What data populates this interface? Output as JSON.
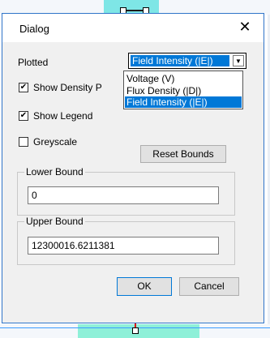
{
  "dialog": {
    "title": "Dialog",
    "close_glyph": "✕"
  },
  "plotted": {
    "label": "Plotted",
    "selected": "Field Intensity (|E|)",
    "arrow_glyph": "▼",
    "options": [
      "Voltage (V)",
      "Flux Density (|D|)",
      "Field Intensity (|E|)"
    ]
  },
  "checkboxes": {
    "show_density": {
      "label": "Show Density P",
      "checked": true
    },
    "show_legend": {
      "label": "Show Legend",
      "checked": true
    },
    "greyscale": {
      "label": "Greyscale",
      "checked": false
    }
  },
  "check_glyph": "✔",
  "buttons": {
    "reset_bounds": "Reset Bounds",
    "ok": "OK",
    "cancel": "Cancel"
  },
  "lower_bound": {
    "title": "Lower Bound",
    "value": "0"
  },
  "upper_bound": {
    "title": "Upper Bound",
    "value": "12300016.6211381"
  },
  "colors": {
    "accent": "#0078d7",
    "window_border": "#2f74c9"
  }
}
